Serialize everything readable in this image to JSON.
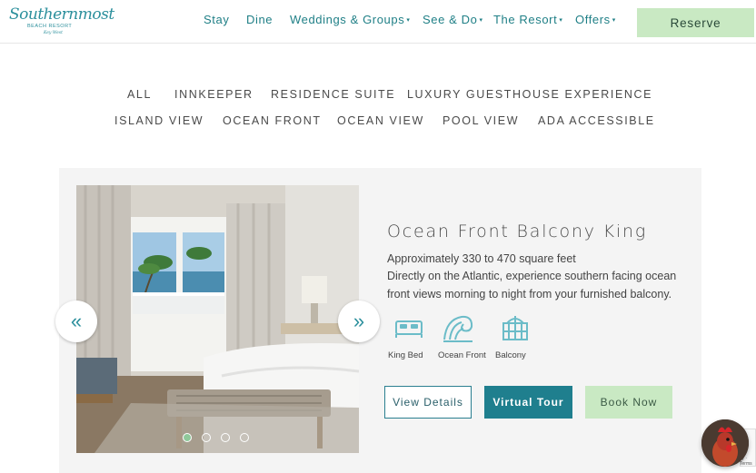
{
  "brand": {
    "logo_main": "Southernmost",
    "logo_sub": "BEACH RESORT",
    "logo_script": "Key West"
  },
  "nav": {
    "items": [
      {
        "label": "Stay",
        "dropdown": false
      },
      {
        "label": "Dine",
        "dropdown": false
      },
      {
        "label": "Weddings & Groups",
        "dropdown": true
      },
      {
        "label": "See & Do",
        "dropdown": true
      },
      {
        "label": "The Resort",
        "dropdown": true
      },
      {
        "label": "Offers",
        "dropdown": true
      }
    ],
    "caret": "▾",
    "reserve_label": "Reserve"
  },
  "filters": {
    "row1": [
      "ALL",
      "INNKEEPER",
      "RESIDENCE SUITE",
      "LUXURY GUESTHOUSE EXPERIENCE"
    ],
    "row2": [
      "ISLAND VIEW",
      "OCEAN FRONT",
      "OCEAN VIEW",
      "POOL VIEW",
      "ADA ACCESSIBLE"
    ]
  },
  "room": {
    "title": "Ocean Front Balcony King",
    "size": "Approximately 330 to 470 square feet",
    "description_line1": "Directly on the Atlantic, experience southern facing ocean",
    "description_line2": "front views morning to night from your furnished balcony.",
    "amenities": [
      {
        "label": "King Bed",
        "icon": "bed-icon"
      },
      {
        "label": "Ocean Front",
        "icon": "wave-icon"
      },
      {
        "label": "Balcony",
        "icon": "balcony-icon"
      }
    ],
    "buttons": {
      "details": "View Details",
      "tour": "Virtual Tour",
      "book": "Book Now"
    }
  },
  "carousel": {
    "prev": "«",
    "next": "»",
    "slide_count": 4,
    "active_index": 0
  },
  "misc": {
    "recaptcha_text": "cy · Terms"
  },
  "colors": {
    "teal": "#1f7f8e",
    "green": "#c9e9c3",
    "card_bg": "#f4f4f4"
  }
}
